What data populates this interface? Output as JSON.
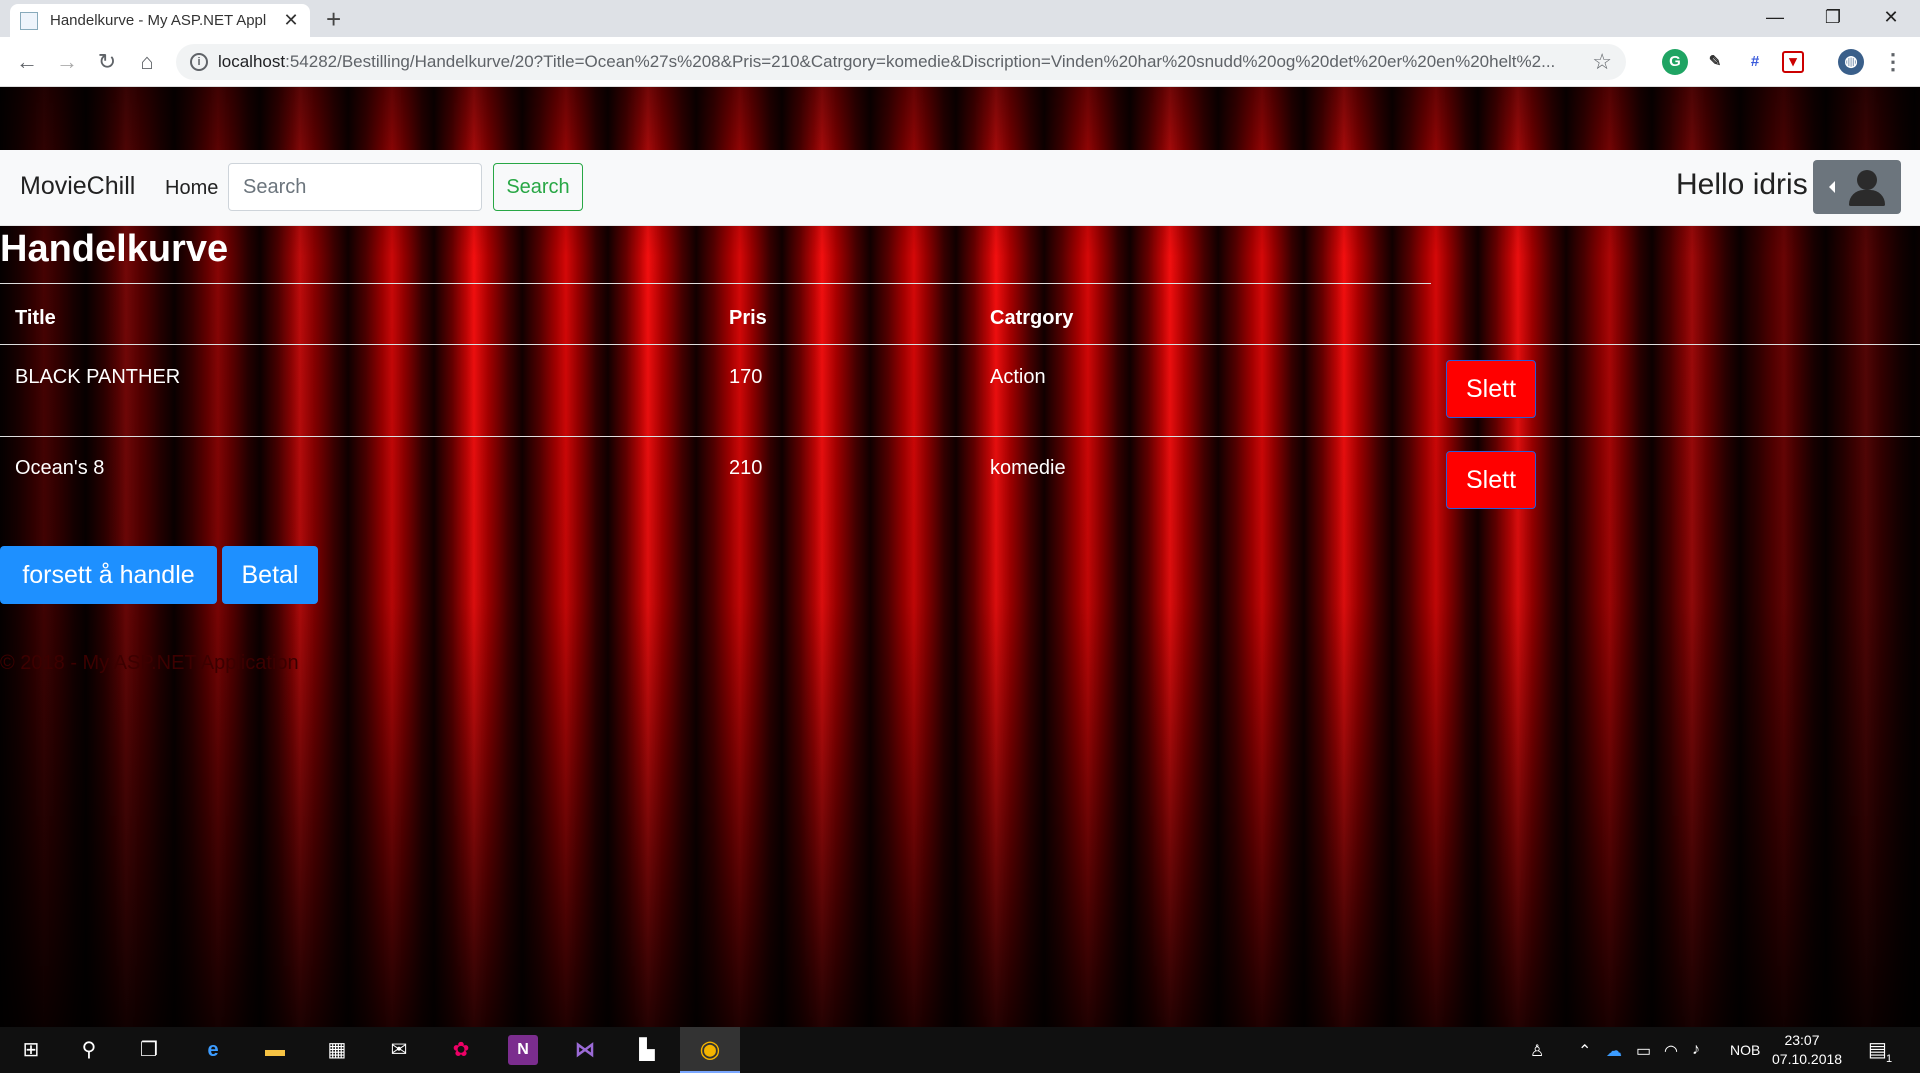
{
  "browser": {
    "tab_title": "Handelkurve - My ASP.NET Appl",
    "new_tab": "+",
    "url_host": "localhost",
    "url_rest": ":54282/Bestilling/Handelkurve/20?Title=Ocean%27s%208&Pris=210&Catrgory=komedie&Discription=Vinden%20har%20snudd%20og%20det%20er%20en%20helt%2...",
    "window_controls": {
      "minimize": "—",
      "restore": "❐",
      "close": "✕"
    }
  },
  "navbar": {
    "brand": "MovieChill",
    "home": "Home",
    "search_placeholder": "Search",
    "search_button": "Search",
    "greeting": "Hello idris"
  },
  "page": {
    "title": "Handelkurve",
    "table": {
      "headers": {
        "title": "Title",
        "pris": "Pris",
        "catrgory": "Catrgory"
      },
      "rows": [
        {
          "title": "BLACK PANTHER",
          "pris": "170",
          "catrgory": "Action",
          "delete_label": "Slett"
        },
        {
          "title": "Ocean's 8",
          "pris": "210",
          "catrgory": "komedie",
          "delete_label": "Slett"
        }
      ]
    },
    "continue_button": "forsett å handle",
    "pay_button": "Betal",
    "footer": "© 2018 - My ASP.NET Application"
  },
  "taskbar": {
    "language": "NOB",
    "time": "23:07",
    "date": "07.10.2018",
    "notification_count": "1"
  },
  "colors": {
    "danger": "#ff0000",
    "primary": "#1e90ff",
    "success": "#28a745",
    "navbar_bg": "#f8f9fa"
  }
}
